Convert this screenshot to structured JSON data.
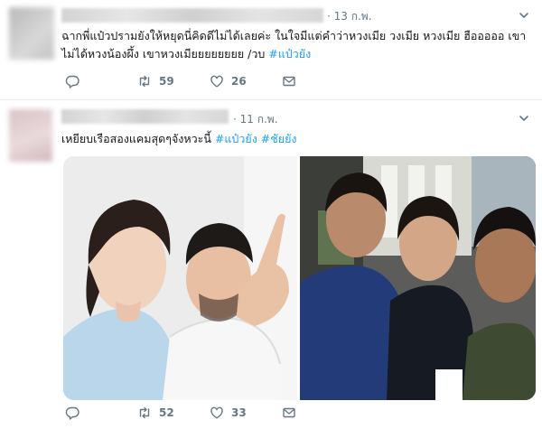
{
  "tweets": [
    {
      "time": "· 13 ก.พ.",
      "text_plain": "ฉากพี่แป๋วปรามยังให้หยุดนี่คิดดีไม่ได้เลยค่ะ ในใจมีแต่คำว่าหวงเมีย วงเมีย หวงเมีย ฮือออออ เขาไม่ได้หวงน้องผึ้ง เขาหวงเมียยยยยยยย /วบ",
      "hashtags": [
        "#แป๋วยัง"
      ],
      "replies": "",
      "retweets": "59",
      "likes": "26"
    },
    {
      "time": "· 11 ก.พ.",
      "text_plain": "เหยียบเรือสองแคมสุดๆจังหวะนี้",
      "hashtags": [
        "#แป๋วยัง",
        "#ชัยยัง"
      ],
      "replies": "",
      "retweets": "52",
      "likes": "33"
    }
  ],
  "icons": {
    "reply": "reply-icon",
    "retweet": "retweet-icon",
    "like": "heart-icon",
    "message": "envelope-icon",
    "menu": "chevron-down-icon"
  },
  "colors": {
    "link": "#1da1f2",
    "muted": "#657786",
    "text": "#14171a",
    "divider": "#e6ecf0"
  }
}
